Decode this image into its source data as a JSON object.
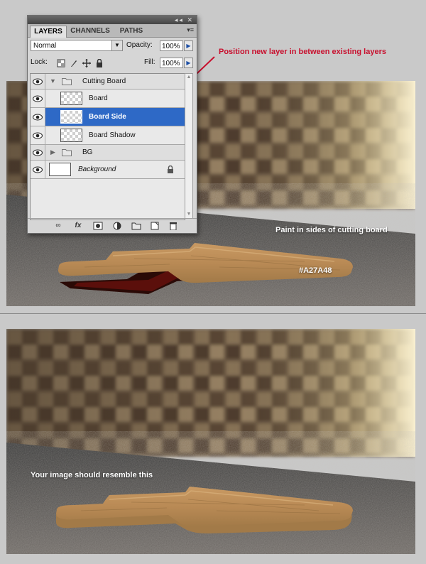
{
  "layers_panel": {
    "tabs": [
      "LAYERS",
      "CHANNELS",
      "PATHS"
    ],
    "blend_mode": "Normal",
    "opacity_label": "Opacity:",
    "opacity_value": "100%",
    "lock_label": "Lock:",
    "fill_label": "Fill:",
    "fill_value": "100%",
    "layers": [
      {
        "name": "Cutting Board",
        "type": "group",
        "expanded": true
      },
      {
        "name": "Board",
        "type": "layer"
      },
      {
        "name": "Board Side",
        "type": "layer",
        "selected": true
      },
      {
        "name": "Board Shadow",
        "type": "layer"
      },
      {
        "name": "BG",
        "type": "group",
        "expanded": false
      },
      {
        "name": "Background",
        "type": "background",
        "locked": true
      }
    ],
    "footer_icons": [
      "link-icon",
      "fx-icon",
      "mask-icon",
      "adjustment-icon",
      "group-folder-icon",
      "new-layer-icon",
      "trash-icon"
    ]
  },
  "annotations": {
    "position_note": "Position new layer in between existing layers",
    "paint_note": "Paint in sides of cutting board",
    "color_code": "#A27A48",
    "resemble_note": "Your image should resemble this"
  },
  "colors": {
    "board_side": "#A27A48",
    "annotation_red": "#C8102E",
    "selection_blue": "#2E69C6"
  }
}
